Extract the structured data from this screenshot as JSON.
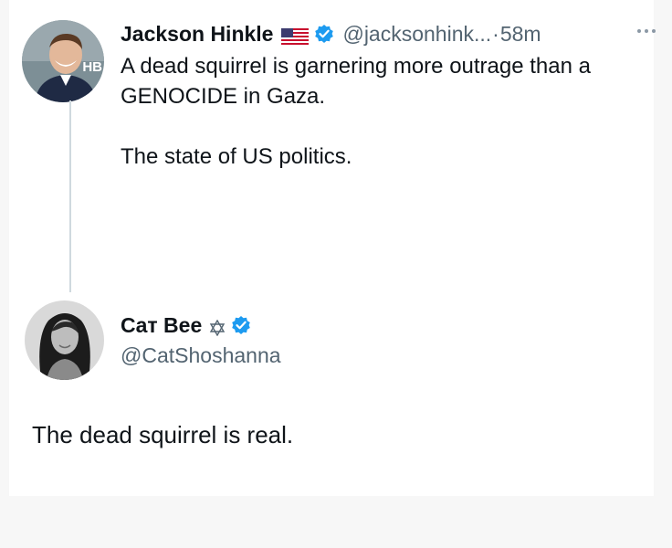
{
  "tweet": {
    "author_name": "Jackson Hinkle",
    "author_flag": "us-flag-icon",
    "author_handle": "@jacksonhink...",
    "separator": "·",
    "time": "58m",
    "avatar_badge_text": "HB",
    "paragraphs": [
      "A dead squirrel is garnering more outrage than a GENOCIDE in Gaza.",
      "The state of US politics."
    ]
  },
  "reply": {
    "author_name": "Cат Bee",
    "author_handle": "@CatShoshanna",
    "text": "The dead squirrel is real."
  },
  "colors": {
    "verified_blue": "#1d9bf0",
    "secondary_text": "#536471",
    "thread_line": "#cfd9de"
  }
}
